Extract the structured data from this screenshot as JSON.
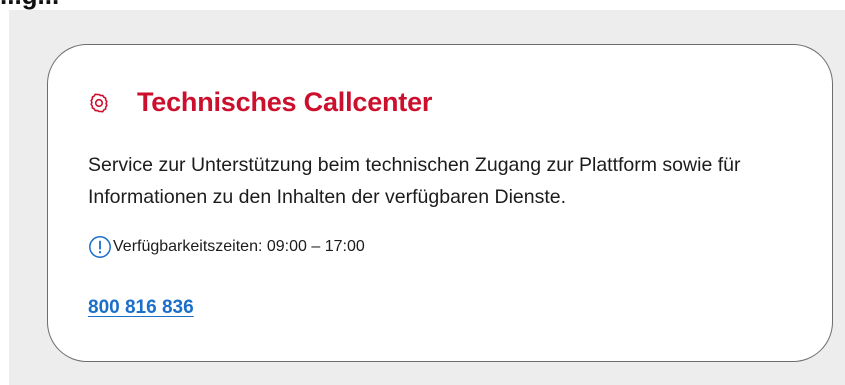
{
  "page": {
    "top_cut_text": "...g..."
  },
  "card": {
    "icon": "gear-icon",
    "title": "Technisches Callcenter",
    "description": "Service zur Unterstützung beim technischen Zugang zur Plattform sowie für Informationen zu den Inhalten der verfügbaren Dienste.",
    "availability_icon": "info-icon",
    "availability": "Verfügbarkeitszeiten: 09:00 – 17:00",
    "phone": "800 816 836"
  },
  "colors": {
    "title": "#cc0f2c",
    "link": "#1a6fc9",
    "panel_background": "#ededed",
    "card_border": "#6d6d6d"
  }
}
